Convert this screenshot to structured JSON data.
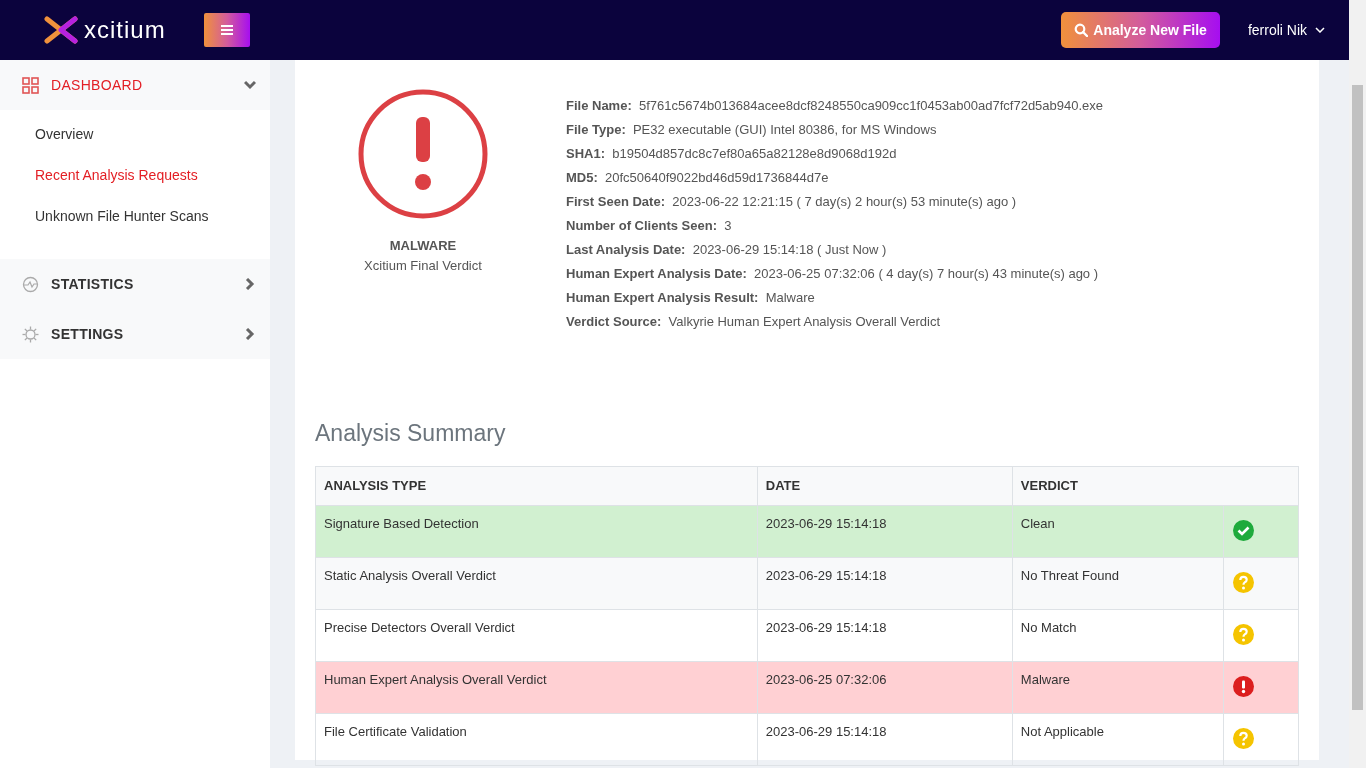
{
  "header": {
    "logo_text": "xcitium",
    "analyze_button": "Analyze New File",
    "user": "ferroli Nik"
  },
  "sidebar": {
    "sections": [
      {
        "label": "DASHBOARD",
        "expanded": true,
        "children": [
          {
            "label": "Overview",
            "selected": false
          },
          {
            "label": "Recent Analysis Requests",
            "selected": true
          },
          {
            "label": "Unknown File Hunter Scans",
            "selected": false
          }
        ]
      },
      {
        "label": "STATISTICS",
        "expanded": false
      },
      {
        "label": "SETTINGS",
        "expanded": false
      }
    ]
  },
  "verdict": {
    "kind": "malware",
    "label": "MALWARE",
    "caption": "Xcitium Final Verdict"
  },
  "details": [
    {
      "label": "File Name:",
      "value": "5f761c5674b013684acee8dcf8248550ca909cc1f0453ab00ad7fcf72d5ab940.exe"
    },
    {
      "label": "File Type:",
      "value": "PE32 executable (GUI) Intel 80386, for MS Windows"
    },
    {
      "label": "SHA1:",
      "value": "b19504d857dc8c7ef80a65a82128e8d9068d192d"
    },
    {
      "label": "MD5:",
      "value": "20fc50640f9022bd46d59d1736844d7e"
    },
    {
      "label": "First Seen Date:",
      "value": "2023-06-22 12:21:15 ( 7 day(s) 2 hour(s) 53 minute(s) ago )"
    },
    {
      "label": "Number of Clients Seen:",
      "value": "3"
    },
    {
      "label": "Last Analysis Date:",
      "value": "2023-06-29 15:14:18 ( Just Now )"
    },
    {
      "label": "Human Expert Analysis Date:",
      "value": "2023-06-25 07:32:06 ( 4 day(s) 7 hour(s) 43 minute(s) ago )"
    },
    {
      "label": "Human Expert Analysis Result:",
      "value": "Malware"
    },
    {
      "label": "Verdict Source:",
      "value": "Valkyrie Human Expert Analysis Overall Verdict"
    }
  ],
  "summary": {
    "title": "Analysis Summary",
    "columns": [
      "ANALYSIS TYPE",
      "DATE",
      "VERDICT"
    ],
    "rows": [
      {
        "kind": "clean",
        "type": "Signature Based Detection",
        "date": "2023-06-29 15:14:18",
        "verdict": "Clean"
      },
      {
        "kind": "unknown",
        "type": "Static Analysis Overall Verdict",
        "date": "2023-06-29 15:14:18",
        "verdict": "No Threat Found"
      },
      {
        "kind": "unknown",
        "type": "Precise Detectors Overall Verdict",
        "date": "2023-06-29 15:14:18",
        "verdict": "No Match"
      },
      {
        "kind": "malware",
        "type": "Human Expert Analysis Overall Verdict",
        "date": "2023-06-25 07:32:06",
        "verdict": "Malware"
      },
      {
        "kind": "unknown",
        "type": "File Certificate Validation",
        "date": "2023-06-29 15:14:18",
        "verdict": "Not Applicable"
      }
    ]
  }
}
